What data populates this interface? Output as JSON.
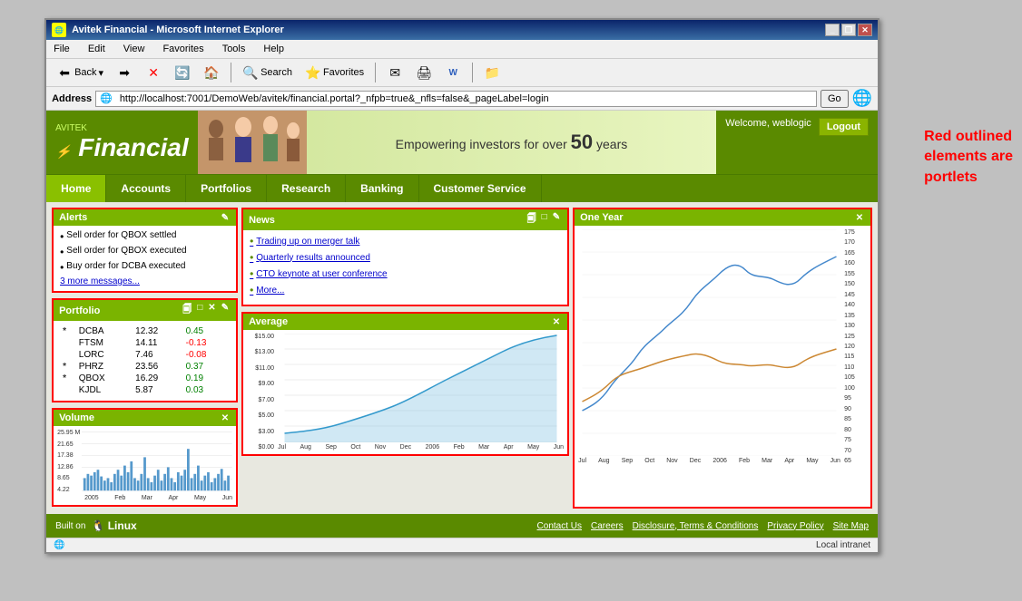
{
  "browser": {
    "title": "Avitek Financial - Microsoft Internet Explorer",
    "address": "http://localhost:7001/DemoWeb/avitek/financial.portal?_nfpb=true&_nfls=false&_pageLabel=login",
    "menu_items": [
      "File",
      "Edit",
      "View",
      "Favorites",
      "Tools",
      "Help"
    ],
    "toolbar": {
      "back_label": "Back",
      "search_label": "Search",
      "favorites_label": "Favorites"
    },
    "status": "Local intranet"
  },
  "site": {
    "logo_small": "AVITEK",
    "logo_main": "Financial",
    "banner_text": "Empowering investors for over ",
    "banner_years": "50",
    "banner_suffix": " years",
    "welcome": "Welcome, weblogic",
    "logout_label": "Logout",
    "nav": [
      "Home",
      "Accounts",
      "Portfolios",
      "Research",
      "Banking",
      "Customer Service"
    ]
  },
  "portlets": {
    "alerts": {
      "title": "Alerts",
      "items": [
        "Sell order for QBOX settled",
        "Sell order for QBOX executed",
        "Buy order for DCBA executed",
        "3 more messages..."
      ]
    },
    "news": {
      "title": "News",
      "items": [
        "Trading up on merger talk",
        "Quarterly results announced",
        "CTO keynote at user conference",
        "More..."
      ]
    },
    "portfolio": {
      "title": "Portfolio",
      "rows": [
        {
          "star": true,
          "symbol": "DCBA",
          "price": "12.32",
          "change": "0.45",
          "positive": true
        },
        {
          "star": false,
          "symbol": "FTSM",
          "price": "14.11",
          "change": "-0.13",
          "positive": false
        },
        {
          "star": false,
          "symbol": "LORC",
          "price": "7.46",
          "change": "-0.08",
          "positive": false
        },
        {
          "star": true,
          "symbol": "PHRZ",
          "price": "23.56",
          "change": "0.37",
          "positive": true
        },
        {
          "star": true,
          "symbol": "QBOX",
          "price": "16.29",
          "change": "0.19",
          "positive": true
        },
        {
          "star": false,
          "symbol": "KJDL",
          "price": "5.87",
          "change": "0.03",
          "positive": true
        }
      ]
    },
    "volume": {
      "title": "Volume"
    },
    "average": {
      "title": "Average",
      "y_max": "$15.00",
      "y_min": "$0.00",
      "x_labels": [
        "Jul",
        "Aug",
        "Sep",
        "Oct",
        "Nov",
        "Dec",
        "2006",
        "Feb",
        "Mar",
        "Apr",
        "May",
        "Jun"
      ]
    },
    "one_year": {
      "title": "One Year",
      "y_labels": [
        "175",
        "170",
        "165",
        "160",
        "155",
        "150",
        "145",
        "140",
        "135",
        "130",
        "125",
        "120",
        "115",
        "110",
        "105",
        "100",
        "95",
        "90",
        "85",
        "80",
        "75",
        "70",
        "65"
      ],
      "x_labels": [
        "Jul",
        "Aug",
        "Sep",
        "Oct",
        "Nov",
        "Dec",
        "2006",
        "Feb",
        "Mar",
        "Apr",
        "May",
        "Jun"
      ]
    }
  },
  "footer": {
    "built_on": "Built on",
    "links": [
      "Contact Us",
      "Careers",
      "Disclosure, Terms & Conditions",
      "Privacy Policy",
      "Site Map"
    ]
  },
  "annotation": {
    "text": "Red outlined\nelements are\nportlets"
  }
}
